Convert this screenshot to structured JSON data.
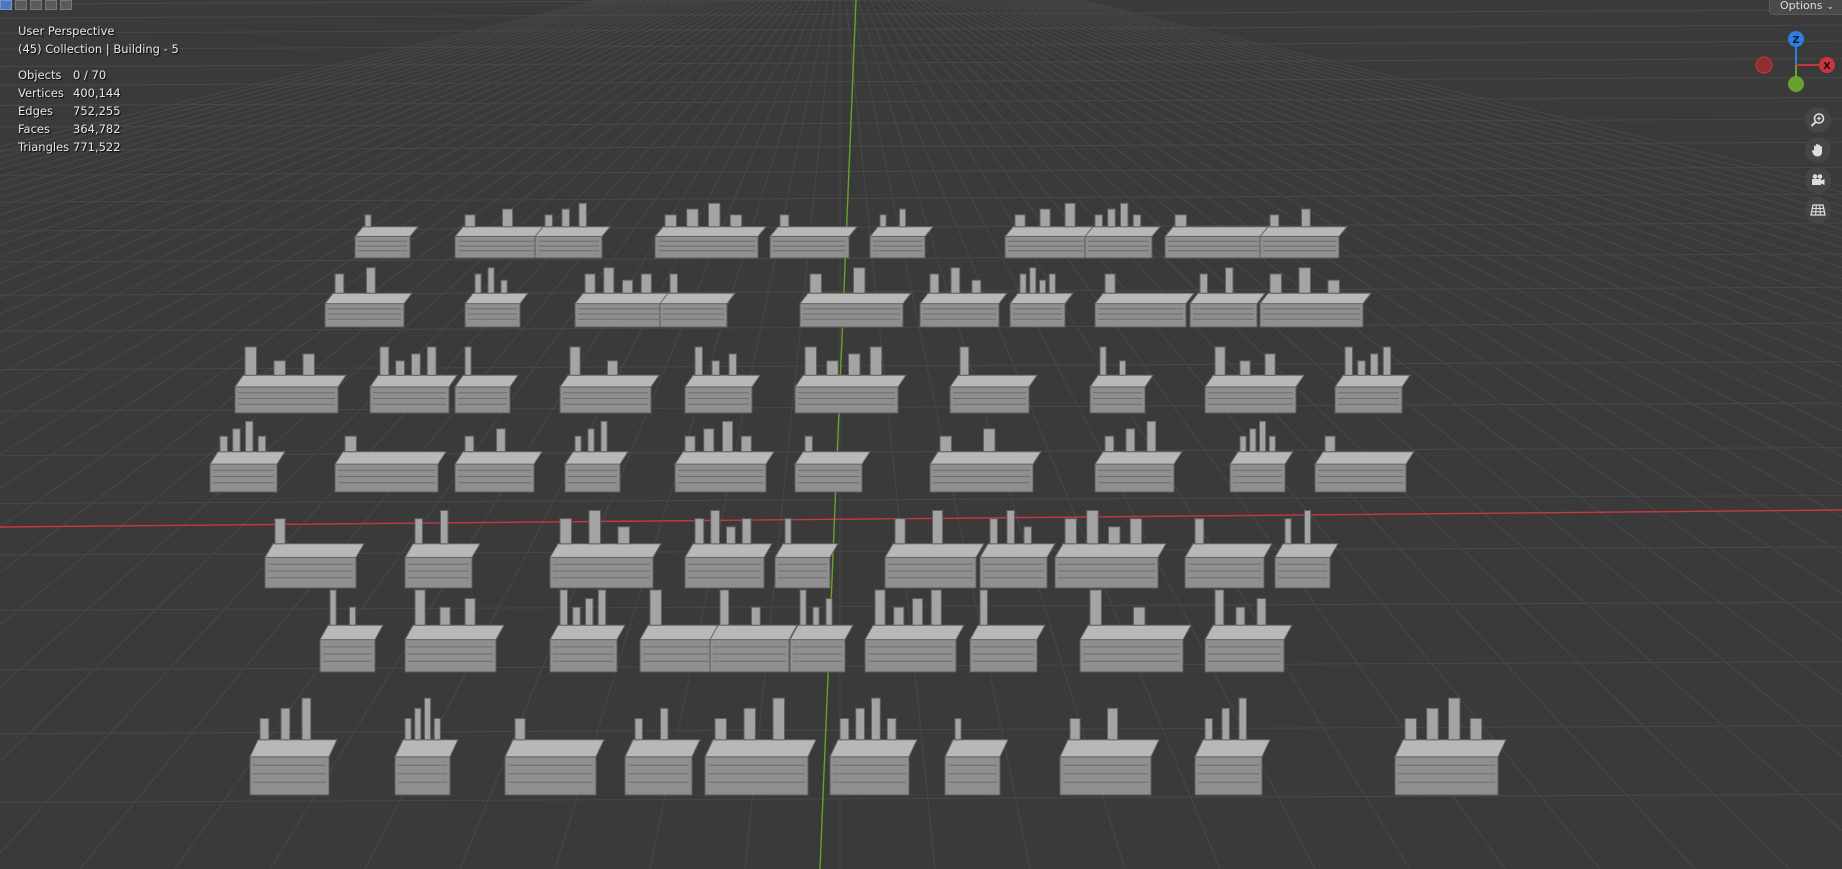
{
  "header": {
    "view_name": "User Perspective",
    "collection": "(45) Collection | Building - 5",
    "options_label": "Options"
  },
  "stats": [
    {
      "label": "Objects",
      "value": "0 / 70"
    },
    {
      "label": "Vertices",
      "value": "400,144"
    },
    {
      "label": "Edges",
      "value": "752,255"
    },
    {
      "label": "Faces",
      "value": "364,782"
    },
    {
      "label": "Triangles",
      "value": "771,522"
    }
  ],
  "gizmo": {
    "z_label": "Z",
    "x_label": "X"
  },
  "nav_icons": [
    "zoom-icon",
    "hand-pan-icon",
    "camera-icon",
    "grid-icon"
  ],
  "colors": {
    "background": "#3a3a3a",
    "grid": "#4a4a4a",
    "x_axis": "#c8373f",
    "y_axis": "#6aa02c",
    "z_axis": "#2e7fdb",
    "model": "#a9a9a9"
  }
}
